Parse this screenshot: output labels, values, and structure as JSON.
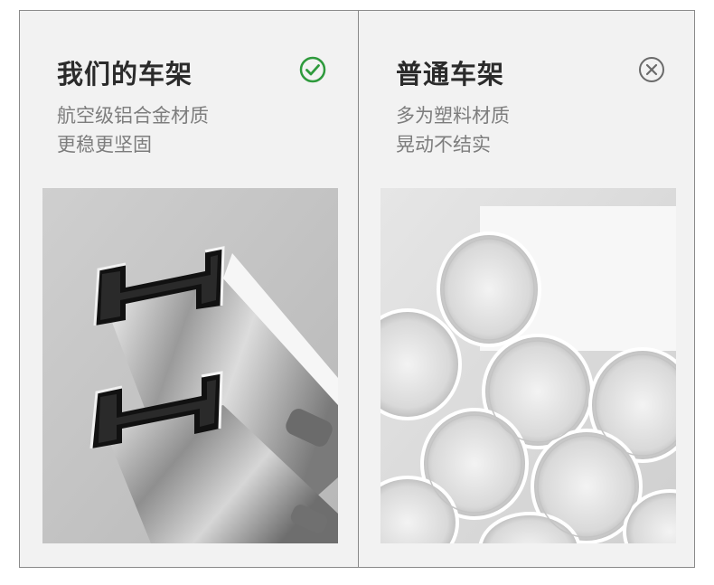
{
  "left_panel": {
    "title": "我们的车架",
    "lines": [
      "航空级铝合金材质",
      "更稳更坚固"
    ],
    "status_icon": "check-circle-icon",
    "status_color": "#2e9a3c"
  },
  "right_panel": {
    "title": "普通车架",
    "lines": [
      "多为塑料材质",
      "晃动不结实"
    ],
    "status_icon": "x-circle-icon",
    "status_color": "#6a6a6a"
  }
}
